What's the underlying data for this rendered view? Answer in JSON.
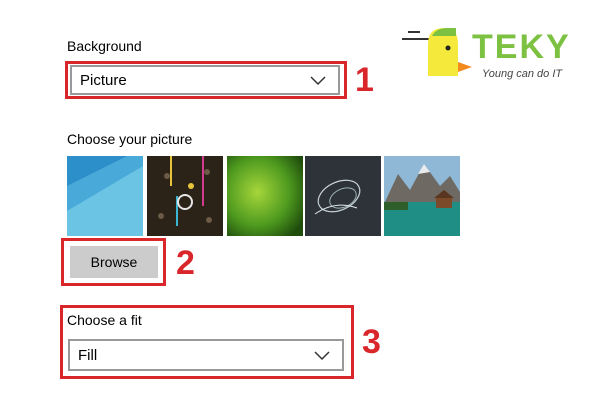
{
  "background": {
    "label": "Background",
    "value": "Picture",
    "callout_number": "1"
  },
  "picture": {
    "label": "Choose your picture",
    "thumbnails": [
      "blue-abstract",
      "dark-pattern",
      "green-gradient",
      "dark-swirl",
      "mountain-lake"
    ],
    "browse_label": "Browse",
    "callout_number": "2"
  },
  "fit": {
    "label": "Choose a fit",
    "value": "Fill",
    "callout_number": "3"
  },
  "logo": {
    "name": "TEKY",
    "tagline": "Young can do IT"
  },
  "colors": {
    "callout_red": "#d9262b",
    "logo_green": "#7dc142",
    "logo_yellow": "#f5e93b",
    "button_gray": "#cccccc"
  }
}
